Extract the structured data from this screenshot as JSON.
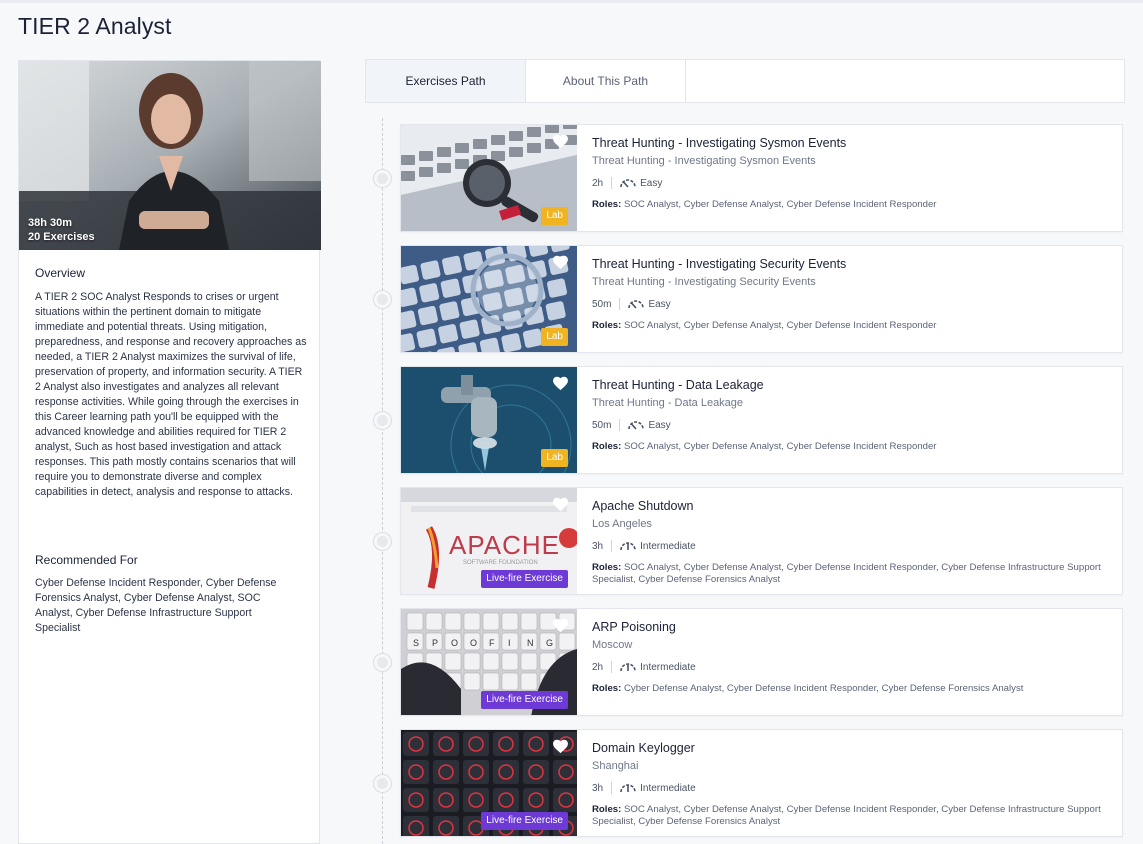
{
  "page": {
    "title": "TIER 2 Analyst"
  },
  "hero": {
    "duration": "38h 30m",
    "exercises": "20 Exercises"
  },
  "overview": {
    "title": "Overview",
    "text": "A TIER 2 SOC Analyst Responds to crises or urgent situations within the pertinent domain to mitigate immediate and potential threats. Using mitigation, preparedness, and response and recovery approaches as needed, a TIER 2 Analyst maximizes the survival of life, preservation of property, and information security. A TIER 2 Analyst also investigates and analyzes all relevant response activities. While going through the exercises in this Career learning path you'll be equipped with the advanced knowledge and abilities required for TIER 2 analyst, Such as host based investigation and attack responses. This path mostly contains scenarios that will require you to demonstrate diverse and complex capabilities in detect, analysis and response to attacks."
  },
  "recommended": {
    "title": "Recommended For",
    "text": "Cyber Defense Incident Responder, Cyber Defense Forensics Analyst, Cyber Defense Analyst, SOC Analyst, Cyber Defense Infrastructure Support Specialist"
  },
  "tabs": [
    {
      "label": "Exercises Path",
      "active": true
    },
    {
      "label": "About This Path",
      "active": false
    }
  ],
  "roles_label": "Roles:",
  "colors": {
    "lab": "#f0b322",
    "livefire": "#6e3ad6",
    "accent": "#1b2236"
  },
  "exercises": [
    {
      "title": "Threat Hunting - Investigating Sysmon Events",
      "subtitle": "Threat Hunting - Investigating Sysmon Events",
      "duration": "2h",
      "difficulty": "Easy",
      "difficulty_icon": "easy-gauge-icon",
      "roles": "SOC Analyst, Cyber Defense Analyst, Cyber Defense Incident Responder",
      "badge": "Lab",
      "thumb": "magnifier-laptop"
    },
    {
      "title": "Threat Hunting - Investigating Security Events",
      "subtitle": "Threat Hunting - Investigating Security Events",
      "duration": "50m",
      "difficulty": "Easy",
      "difficulty_icon": "easy-gauge-icon",
      "roles": "SOC Analyst, Cyber Defense Analyst, Cyber Defense Incident Responder",
      "badge": "Lab",
      "thumb": "keyboard-magnifier"
    },
    {
      "title": "Threat Hunting - Data Leakage",
      "subtitle": "Threat Hunting - Data Leakage",
      "duration": "50m",
      "difficulty": "Easy",
      "difficulty_icon": "easy-gauge-icon",
      "roles": "SOC Analyst, Cyber Defense Analyst, Cyber Defense Incident Responder",
      "badge": "Lab",
      "thumb": "faucet"
    },
    {
      "title": "Apache Shutdown",
      "subtitle": "Los Angeles",
      "duration": "3h",
      "difficulty": "Intermediate",
      "difficulty_icon": "intermediate-gauge-icon",
      "roles": "SOC Analyst, Cyber Defense Analyst, Cyber Defense Incident Responder, Cyber Defense Infrastructure Support Specialist, Cyber Defense Forensics Analyst",
      "badge": "Live-fire Exercise",
      "thumb": "apache"
    },
    {
      "title": "ARP Poisoning",
      "subtitle": "Moscow",
      "duration": "2h",
      "difficulty": "Intermediate",
      "difficulty_icon": "intermediate-gauge-icon",
      "roles": "Cyber Defense Analyst, Cyber Defense Incident Responder, Cyber Defense Forensics Analyst",
      "badge": "Live-fire Exercise",
      "thumb": "spoofing-keyboard"
    },
    {
      "title": "Domain Keylogger",
      "subtitle": "Shanghai",
      "duration": "3h",
      "difficulty": "Intermediate",
      "difficulty_icon": "intermediate-gauge-icon",
      "roles": "SOC Analyst, Cyber Defense Analyst, Cyber Defense Incident Responder, Cyber Defense Infrastructure Support Specialist, Cyber Defense Forensics Analyst",
      "badge": "Live-fire Exercise",
      "thumb": "red-keys"
    }
  ]
}
